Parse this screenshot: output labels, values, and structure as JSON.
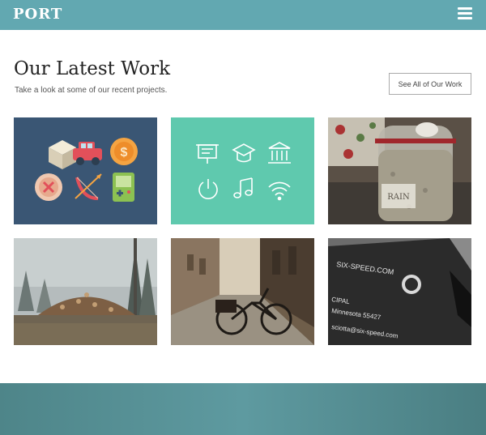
{
  "header": {
    "logo": "PORT",
    "menu_icon": "hamburger-menu-icon",
    "bg_color": "#62a8b1"
  },
  "main": {
    "title": "Our Latest Work",
    "subtitle": "Take a look at some of our recent projects.",
    "see_all_label": "See All of Our Work",
    "projects": [
      {
        "kind": "icon-grid",
        "icons": [
          "cube-icon",
          "car-icon",
          "dollar-coin-icon",
          "button-icon",
          "bow-arrow-icon",
          "gameboy-icon"
        ],
        "bg": "#3a5674"
      },
      {
        "kind": "icon-grid",
        "icons": [
          "presentation-icon",
          "graduation-cap-icon",
          "bank-icon",
          "power-icon",
          "music-note-icon",
          "wifi-icon"
        ],
        "bg": "#5fc9ae"
      },
      {
        "kind": "photo",
        "subject": "jar-photo",
        "jar_label": "RAIN"
      },
      {
        "kind": "photo",
        "subject": "woodpile-forest-photo"
      },
      {
        "kind": "photo",
        "subject": "street-bicycle-photo"
      },
      {
        "kind": "photo",
        "subject": "business-card-photo",
        "card_lines": [
          "SIX-SPEED.COM",
          "CIPAL",
          "Minnesota 55427",
          "sciotta@six-speed.com"
        ]
      }
    ]
  },
  "footer": {
    "color": "#5e9aa0"
  }
}
